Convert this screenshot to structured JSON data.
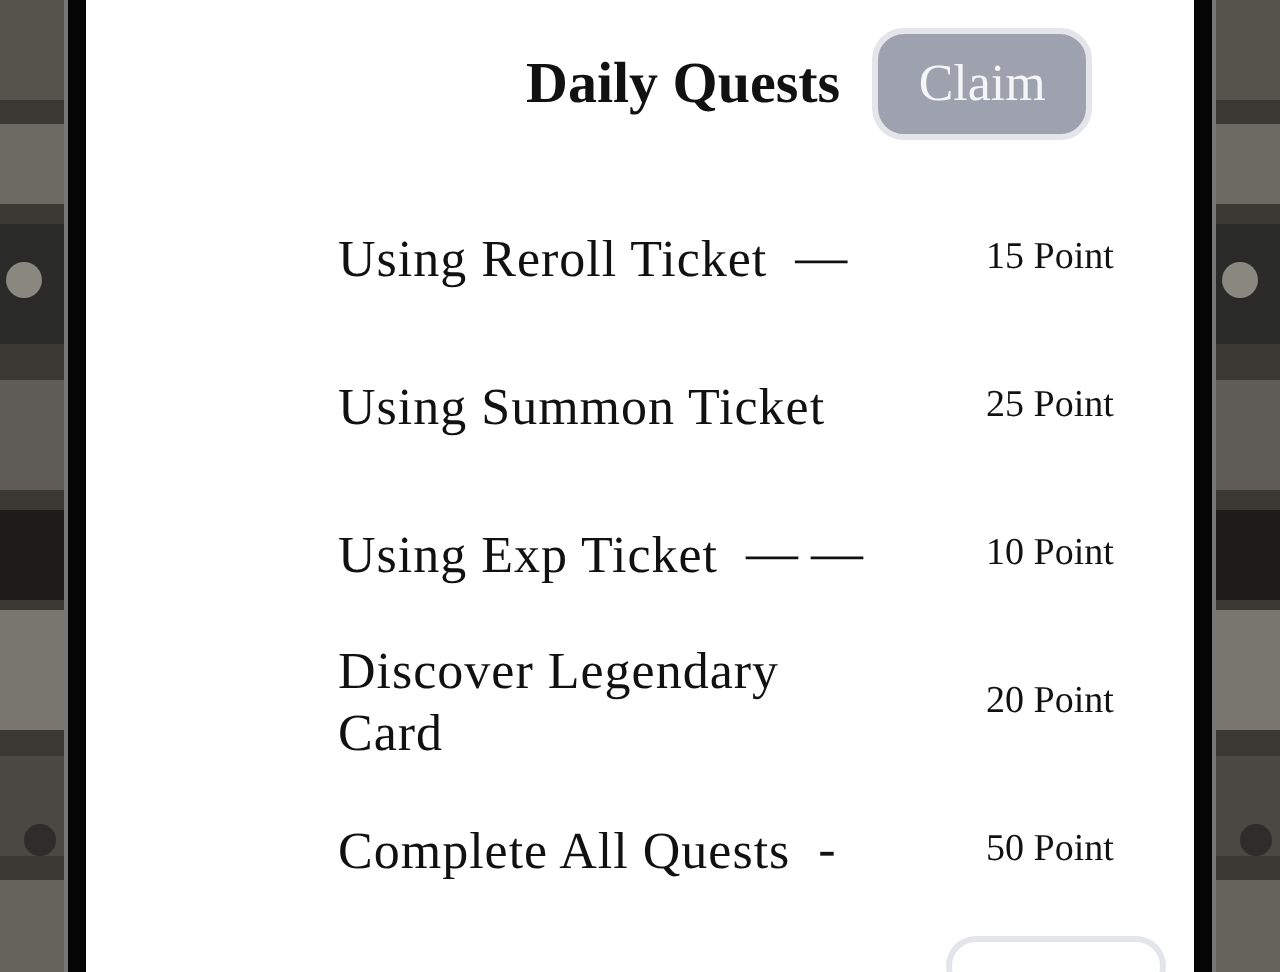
{
  "title": "Daily Quests",
  "claim_button": {
    "label": "Claim",
    "disabled": true
  },
  "quests": [
    {
      "label": "Using Reroll Ticket",
      "separator": "—",
      "reward": "15 Point"
    },
    {
      "label": "Using Summon Ticket",
      "reward": "25 Point"
    },
    {
      "label": "Using Exp Ticket",
      "separator": "— —",
      "reward": "10 Point"
    },
    {
      "label": "Discover Legendary Card",
      "reward": "20 Point"
    },
    {
      "label": "Complete All Quests",
      "separator": "-",
      "reward": "50 Point"
    }
  ]
}
